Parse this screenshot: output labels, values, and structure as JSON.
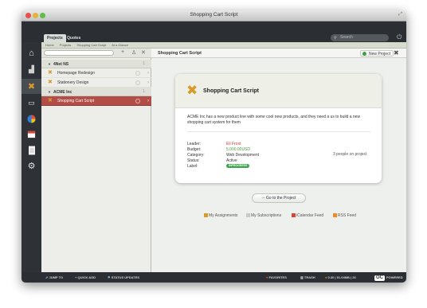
{
  "window": {
    "title": "Shopping Cart Script"
  },
  "topbar": {
    "tabs": [
      {
        "label": "Projects"
      },
      {
        "label": "Quotes"
      }
    ],
    "search_placeholder": "Search"
  },
  "breadcrumb": [
    "Home",
    "Projects",
    "Shopping Cart Script",
    "At a Glance"
  ],
  "sidebar": {
    "icons": [
      "home-icon",
      "chart-icon",
      "tools-icon",
      "monitor-icon",
      "pie-chart-icon",
      "calendar-icon",
      "document-icon",
      "settings-icon"
    ]
  },
  "projects": {
    "groups": [
      {
        "name": "4Net NS",
        "count": "1",
        "items": [
          {
            "label": "Homepage Redesign"
          },
          {
            "label": "Stationery Design"
          }
        ]
      },
      {
        "name": "ACME Inc",
        "count": "1",
        "items": [
          {
            "label": "Shopping Cart Script"
          }
        ]
      }
    ]
  },
  "main": {
    "title": "Shopping Cart Script",
    "new_project_label": "New Project",
    "card": {
      "title": "Shopping Cart Script",
      "description": "ACME Inc has a new product line with some cool new products, and they need a us to build a new shopping cart system for them",
      "fields": [
        {
          "key": "Leader:",
          "value": "Eli Frost"
        },
        {
          "key": "Budget:",
          "value": "5,000.00USD"
        },
        {
          "key": "Category:",
          "value": "Web Development"
        },
        {
          "key": "Status:",
          "value": "Active"
        },
        {
          "key": "Label:",
          "value": "INPROGRESS"
        }
      ],
      "people": "3 people on project"
    },
    "goto_label": "Go to the Project",
    "links": [
      "My Assignments",
      "My Subscriptions",
      "iCalendar Feed",
      "RSS Feed"
    ]
  },
  "bottombar": {
    "jump_to": "JUMP TO",
    "quick_add": "QUICK ADD",
    "status_updates": "STATUS UPDATES",
    "favorites": "FAVORITES",
    "trash": "TRASH",
    "usage": "0.30 | 51.04MB | 26",
    "powered": "POWERED"
  },
  "colors": {
    "accent": "#b24d48",
    "active_badge": "#3ca54a",
    "sidebar": "#2e3236"
  }
}
